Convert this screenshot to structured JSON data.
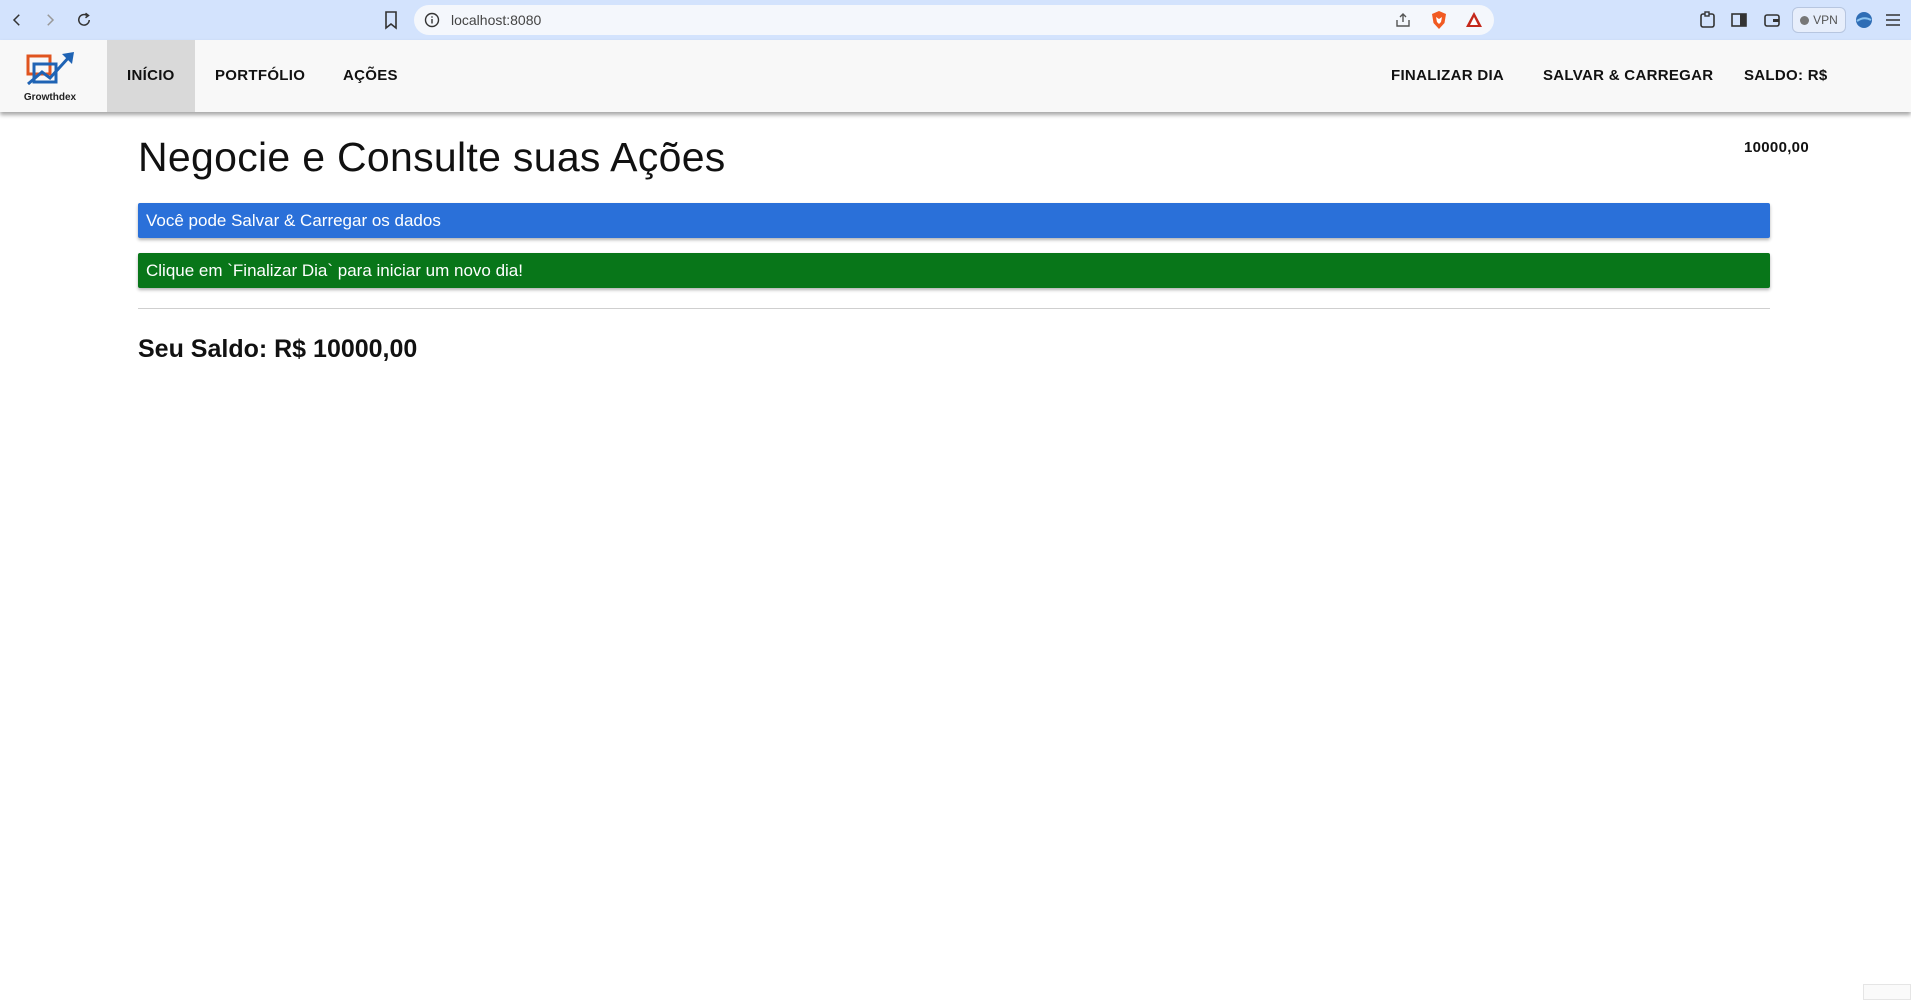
{
  "browser": {
    "url": "localhost:8080",
    "vpn_label": "VPN"
  },
  "app": {
    "logo_text": "Growthdex",
    "nav_left": [
      "INÍCIO",
      "PORTFÓLIO",
      "AÇÕES"
    ],
    "nav_right": {
      "finalize": "FINALIZAR DIA",
      "save_load": "SALVAR & CARREGAR",
      "balance": "SALDO: R$ 10000,00"
    }
  },
  "main": {
    "title": "Negocie e Consulte suas Ações",
    "alert_info": "Você pode Salvar & Carregar os dados",
    "alert_success": "Clique em `Finalizar Dia` para iniciar um novo dia!",
    "balance_text": "Seu Saldo: R$ 10000,00"
  },
  "colors": {
    "chrome": "#d3e3fd",
    "alert_blue": "#2a70d9",
    "alert_green": "#087619",
    "active_nav": "#d9d9d9"
  },
  "icons": [
    "back-icon",
    "forward-icon",
    "reload-icon",
    "bookmark-icon",
    "info-icon",
    "share-icon",
    "brave-shield-icon",
    "brave-rewards-icon",
    "extensions-icon",
    "sidebar-icon",
    "wallet-icon",
    "profile-icon",
    "menu-icon"
  ]
}
